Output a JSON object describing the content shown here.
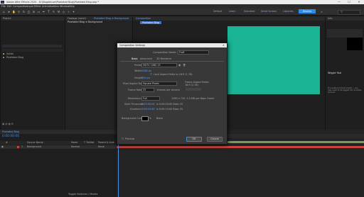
{
  "window": {
    "title": "Adobe After Effects 2020 - D:\\Blogdeluxe\\Pixelated Blog\\Pixelated Blog.aep *",
    "min": "—",
    "max": "☐",
    "close": "✕",
    "logo": "Ae"
  },
  "menu": [
    "File",
    "Edit",
    "Composition",
    "Layer",
    "Effect",
    "Animation",
    "View",
    "Window",
    "Help"
  ],
  "workspaces": {
    "items": [
      "Default",
      "Learn",
      "Standard",
      "Small Screen",
      "Libraries"
    ],
    "active": "Review"
  },
  "project": {
    "tab": "Project",
    "items": [
      "Solids",
      "Pixelated Blog"
    ]
  },
  "viewer": {
    "tab": "Composition",
    "comp_name": "Pixelated Blog",
    "footage_tab": "Footage (none)",
    "layer_tab": "Pixelated Blog ≡ Background",
    "pill": "Pixelated Blog"
  },
  "right_panel": {
    "tab": "Info",
    "section": "Wiggle Tool",
    "message": "If a sentence found inherit... you may need to be logged into a Adobe account"
  },
  "dialog": {
    "title": "Composition Settings",
    "name_label": "Composition Name:",
    "name_value": "Fluff",
    "tabs": [
      "Basic",
      "Advanced",
      "3D Renderer"
    ],
    "preset_label": "Preset:",
    "preset_value": "HDTV 1080 25",
    "width_label": "Width:",
    "width_value": "1280 px",
    "height_label": "Height:",
    "height_value": "720 px",
    "lock_label": "Lock Aspect Ratio to 16:9 (1.78)",
    "par_label": "Pixel Aspect Ratio:",
    "par_value": "Square Pixels",
    "frame_aspect_label": "Frame Aspect Ratio:",
    "frame_aspect_value": "16:9 (1.78)",
    "fr_label": "Frame Rate:",
    "fr_value": "25",
    "fr_unit": "frames per second",
    "res_label": "Resolution:",
    "res_value": "Full",
    "res_info": "1280 x 720, 3.5 MB per 8bpc frame",
    "start_label": "Start Timecode:",
    "start_value": "0:00:00:00",
    "start_info": "is 0:00:00:00  Base 25",
    "dur_label": "Duration:",
    "dur_value": "0:00:10:00",
    "dur_info": "is 0:00:10:00  Base 25",
    "bg_label": "Background Color:",
    "bg_value": "Black",
    "bg_color": "#000000",
    "preview_label": "Preview",
    "ok": "OK",
    "cancel": "Cancel"
  },
  "timeline": {
    "timecode": "0:00:00:00",
    "comp_tab": "Pixelated Blog",
    "headers": [
      "#",
      "Source Name",
      "Mode",
      "T TrkMat",
      "Parent & Link"
    ],
    "layer": {
      "num": "1",
      "name": "Background",
      "mode": "Normal",
      "parent": "None"
    },
    "toggle": "Toggle Switches / Modes",
    "bar_color": "#c8453f",
    "bar2_color": "#7a9a5a"
  },
  "canvas_color": "#1ab394"
}
